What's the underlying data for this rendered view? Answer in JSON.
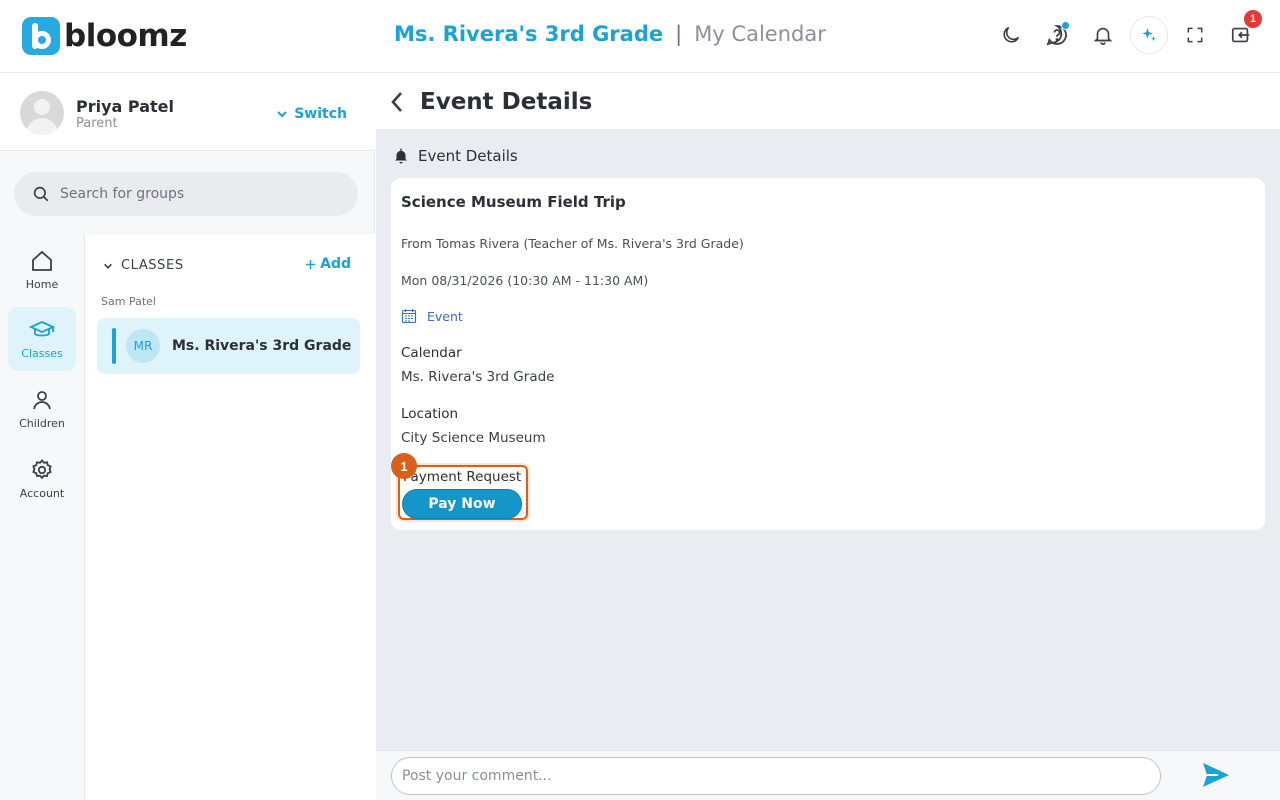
{
  "brand": {
    "name": "bloomz"
  },
  "header": {
    "group_name": "Ms. Rivera's 3rd Grade",
    "separator": "|",
    "section": "My Calendar",
    "notification_badge": "1"
  },
  "profile": {
    "name": "Priya Patel",
    "role": "Parent",
    "switch_label": "Switch"
  },
  "search": {
    "placeholder": "Search for groups"
  },
  "nav": {
    "items": [
      {
        "label": "Home",
        "icon": "home-icon"
      },
      {
        "label": "Classes",
        "icon": "graduation-cap-icon"
      },
      {
        "label": "Children",
        "icon": "person-icon"
      },
      {
        "label": "Account",
        "icon": "gear-icon"
      }
    ],
    "active": "Classes"
  },
  "groups": {
    "heading": "CLASSES",
    "add_label": "Add",
    "child_name": "Sam Patel",
    "items": [
      {
        "initials": "MR",
        "name": "Ms. Rivera's 3rd Grade"
      }
    ]
  },
  "page": {
    "title": "Event Details",
    "section_title": "Event Details"
  },
  "event": {
    "title": "Science Museum Field Trip",
    "from": "From Tomas Rivera (Teacher of Ms. Rivera's 3rd Grade)",
    "datetime": "Mon 08/31/2026 (10:30 AM - 11:30 AM)",
    "type": "Event",
    "calendar_label": "Calendar",
    "calendar_value": "Ms. Rivera's 3rd Grade",
    "location_label": "Location",
    "location_value": "City Science Museum",
    "payment_label": "Payment Request",
    "pay_button": "Pay Now",
    "step_marker": "1"
  },
  "comment": {
    "placeholder": "Post your comment..."
  },
  "colors": {
    "accent": "#1aa3d4",
    "highlight": "#d9601a",
    "badge": "#e53935"
  }
}
